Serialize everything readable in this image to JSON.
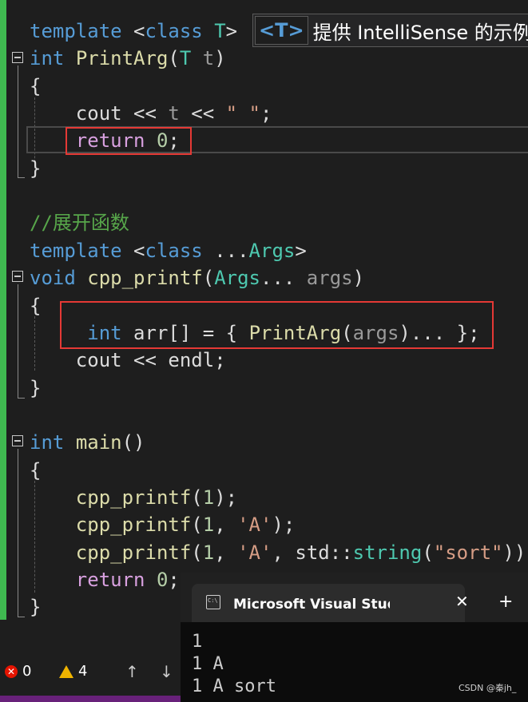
{
  "editor": {
    "lines": [
      {
        "tokens": [
          [
            "kw",
            "template"
          ],
          [
            "plain",
            " <"
          ],
          [
            "kw",
            "class"
          ],
          [
            "plain",
            " "
          ],
          [
            "ty",
            "T"
          ],
          [
            "plain",
            ">"
          ]
        ]
      },
      {
        "tokens": [
          [
            "kw",
            "int"
          ],
          [
            "plain",
            " "
          ],
          [
            "fn",
            "PrintArg"
          ],
          [
            "plain",
            "("
          ],
          [
            "ty",
            "T"
          ],
          [
            "plain",
            " "
          ],
          [
            "pa",
            "t"
          ],
          [
            "plain",
            ")"
          ]
        ]
      },
      {
        "tokens": [
          [
            "plain",
            "{"
          ]
        ]
      },
      {
        "tokens": [
          [
            "plain",
            "    cout << "
          ],
          [
            "pa",
            "t"
          ],
          [
            "plain",
            " << "
          ],
          [
            "str",
            "\" \""
          ],
          [
            "plain",
            ";"
          ]
        ]
      },
      {
        "tokens": [
          [
            "plain",
            "    "
          ],
          [
            "ctl",
            "return"
          ],
          [
            "plain",
            " "
          ],
          [
            "num",
            "0"
          ],
          [
            "plain",
            ";"
          ]
        ]
      },
      {
        "tokens": [
          [
            "plain",
            "}"
          ]
        ]
      },
      {
        "tokens": []
      },
      {
        "tokens": [
          [
            "cm",
            "//展开函数"
          ]
        ]
      },
      {
        "tokens": [
          [
            "kw",
            "template"
          ],
          [
            "plain",
            " <"
          ],
          [
            "kw",
            "class"
          ],
          [
            "plain",
            " ..."
          ],
          [
            "ty",
            "Args"
          ],
          [
            "plain",
            ">"
          ]
        ]
      },
      {
        "tokens": [
          [
            "kw",
            "void"
          ],
          [
            "plain",
            " "
          ],
          [
            "fn",
            "cpp_printf"
          ],
          [
            "plain",
            "("
          ],
          [
            "ty",
            "Args"
          ],
          [
            "plain",
            "... "
          ],
          [
            "pa",
            "args"
          ],
          [
            "plain",
            ")"
          ]
        ]
      },
      {
        "tokens": [
          [
            "plain",
            "{"
          ]
        ]
      },
      {
        "tokens": [
          [
            "plain",
            "     "
          ],
          [
            "kw",
            "int"
          ],
          [
            "plain",
            " arr[] = { "
          ],
          [
            "fn",
            "PrintArg"
          ],
          [
            "plain",
            "("
          ],
          [
            "pa",
            "args"
          ],
          [
            "plain",
            ")... };"
          ]
        ]
      },
      {
        "tokens": [
          [
            "plain",
            "    cout << endl;"
          ]
        ]
      },
      {
        "tokens": [
          [
            "plain",
            "}"
          ]
        ]
      },
      {
        "tokens": []
      },
      {
        "tokens": [
          [
            "kw",
            "int"
          ],
          [
            "plain",
            " "
          ],
          [
            "fn",
            "main"
          ],
          [
            "plain",
            "()"
          ]
        ]
      },
      {
        "tokens": [
          [
            "plain",
            "{"
          ]
        ]
      },
      {
        "tokens": [
          [
            "plain",
            "    "
          ],
          [
            "fn",
            "cpp_printf"
          ],
          [
            "plain",
            "("
          ],
          [
            "num",
            "1"
          ],
          [
            "plain",
            ");"
          ]
        ]
      },
      {
        "tokens": [
          [
            "plain",
            "    "
          ],
          [
            "fn",
            "cpp_printf"
          ],
          [
            "plain",
            "("
          ],
          [
            "num",
            "1"
          ],
          [
            "plain",
            ", "
          ],
          [
            "str",
            "'A'"
          ],
          [
            "plain",
            ");"
          ]
        ]
      },
      {
        "tokens": [
          [
            "plain",
            "    "
          ],
          [
            "fn",
            "cpp_printf"
          ],
          [
            "plain",
            "("
          ],
          [
            "num",
            "1"
          ],
          [
            "plain",
            ", "
          ],
          [
            "str",
            "'A'"
          ],
          [
            "plain",
            ", std::"
          ],
          [
            "ty",
            "string"
          ],
          [
            "plain",
            "("
          ],
          [
            "str",
            "\"sort\""
          ],
          [
            "plain",
            "));"
          ]
        ]
      },
      {
        "tokens": [
          [
            "plain",
            "    "
          ],
          [
            "ctl",
            "return"
          ],
          [
            "plain",
            " "
          ],
          [
            "num",
            "0"
          ],
          [
            "plain",
            ";"
          ]
        ]
      },
      {
        "tokens": [
          [
            "plain",
            "}"
          ]
        ]
      }
    ]
  },
  "tooltip": {
    "badge": "<T>",
    "text": "提供 IntelliSense 的示例"
  },
  "status": {
    "errors": "0",
    "warnings": "4",
    "up_arrow": "↑",
    "down_arrow": "↓"
  },
  "console": {
    "title": "Microsoft Visual Studio 调试控制台",
    "close": "✕",
    "plus": "+",
    "output": [
      "1",
      "1 A",
      "1 A sort"
    ]
  },
  "watermark": "CSDN @秦jh_",
  "colors": {
    "gutter": "#3fb950",
    "highlight_box": "#e53935",
    "keyword": "#569cd6",
    "type": "#4ec9b0",
    "function": "#dcdcaa"
  }
}
